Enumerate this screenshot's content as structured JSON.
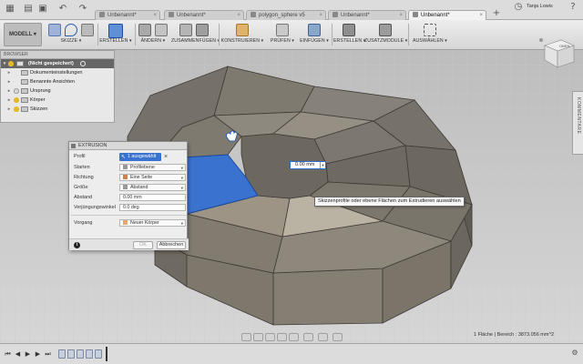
{
  "tabs": [
    {
      "label": "Unbenannt*"
    },
    {
      "label": "Unbenannt*"
    },
    {
      "label": "Unbenannt*"
    },
    {
      "label": "polygon_sphere v5"
    },
    {
      "label": "Unbenannt*"
    },
    {
      "label": "Unbenannt*",
      "active": true
    }
  ],
  "user": {
    "name": "Tanja Lowis"
  },
  "toolbar": {
    "workspace": "MODELL",
    "groups": [
      {
        "label": "SKIZZE"
      },
      {
        "label": "ERSTELLEN"
      },
      {
        "label": "ÄNDERN"
      },
      {
        "label": "ZUSAMMENFÜGEN"
      },
      {
        "label": "KONSTRUIEREN"
      },
      {
        "label": "PRÜFEN"
      },
      {
        "label": "EINFÜGEN"
      },
      {
        "label": "ERSTELLEN"
      },
      {
        "label": "ZUSATZMODULE"
      },
      {
        "label": "AUSWÄHLEN"
      }
    ]
  },
  "browser": {
    "title": "BROWSER",
    "root": "(Nicht gespeichert)",
    "items": [
      {
        "label": "Dokumenteinstellungen"
      },
      {
        "label": "Benannte Ansichten"
      },
      {
        "label": "Ursprung"
      },
      {
        "label": "Körper"
      },
      {
        "label": "Skizzen"
      }
    ]
  },
  "dialog": {
    "title": "EXTRUSION",
    "rows": [
      {
        "label": "Profil",
        "value": "1 ausgewählt"
      },
      {
        "label": "Starten",
        "value": "Profilebene"
      },
      {
        "label": "Richtung",
        "value": "Eine Seite"
      },
      {
        "label": "Größe",
        "value": "Abstand"
      },
      {
        "label": "Abstand",
        "value": "0.00 mm"
      },
      {
        "label": "Verjüngungswinkel",
        "value": "0.0 deg"
      },
      {
        "label": "Vorgang",
        "value": "Neuer Körper"
      }
    ],
    "ok_label": "OK",
    "cancel_label": "Abbrechen"
  },
  "viewport": {
    "distance_value": "0.00 mm",
    "tooltip": "Skizzenprofile oder ebene Flächen zum Extrudieren auswählen",
    "comments_label": "KOMMENTARE",
    "viewcube_label": "OBEN"
  },
  "status": {
    "text": "1 Fläche | Bereich : 3873.056 mm^2"
  },
  "colors": {
    "selected_face": "#3a72d0",
    "body": "#8a8478",
    "accent": "#2d6fd0"
  }
}
